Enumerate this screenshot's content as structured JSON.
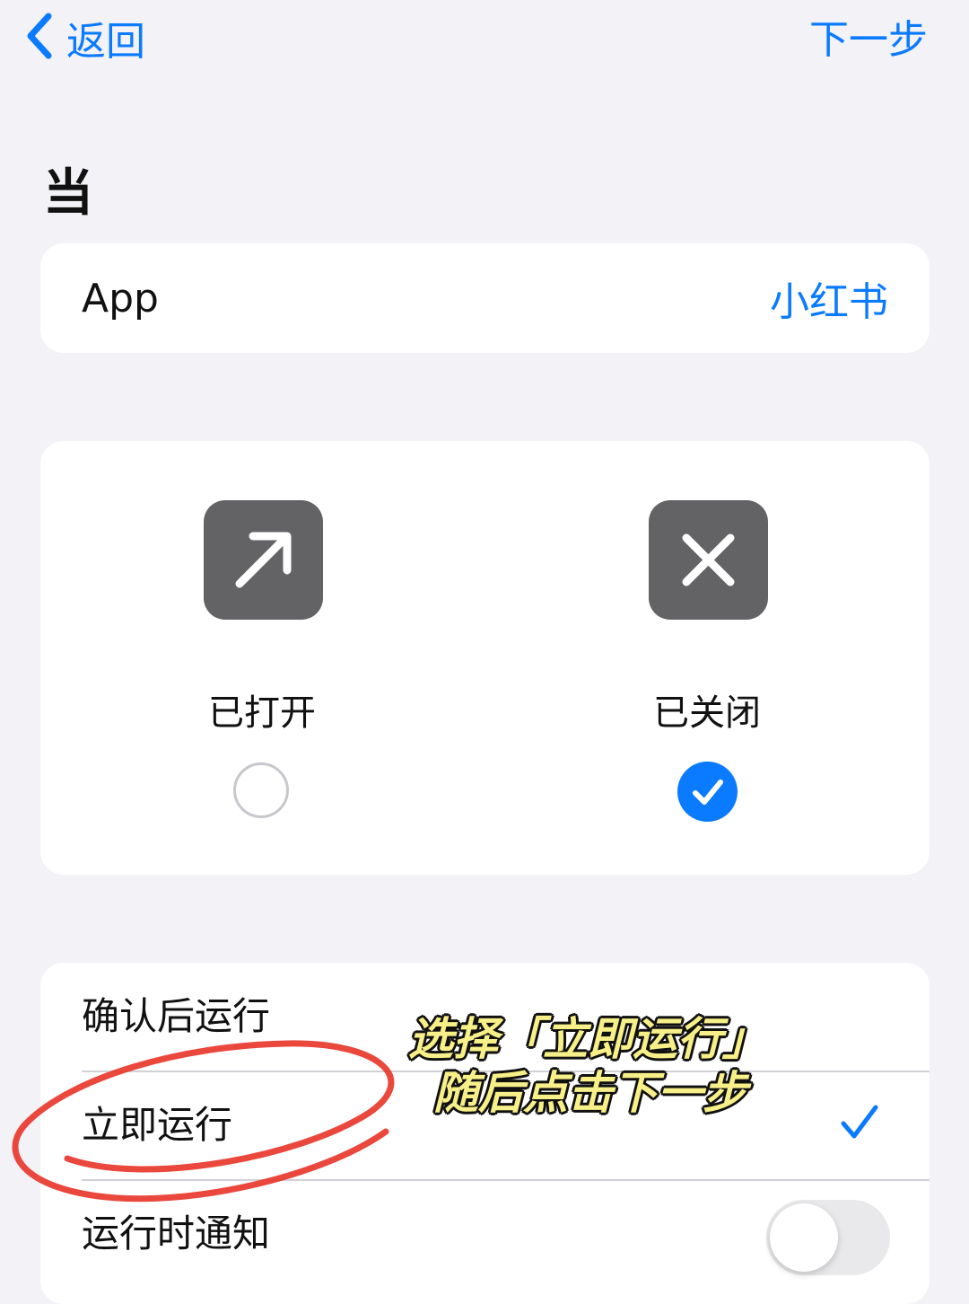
{
  "nav": {
    "back_label": "返回",
    "next_label": "下一步"
  },
  "section": {
    "title": "当"
  },
  "app_row": {
    "label": "App",
    "value": "小红书"
  },
  "state_options": [
    {
      "label": "已打开",
      "icon": "arrow-up-right-icon",
      "selected": false
    },
    {
      "label": "已关闭",
      "icon": "close-x-icon",
      "selected": true
    }
  ],
  "run_options": [
    {
      "label": "确认后运行",
      "checked": false
    },
    {
      "label": "立即运行",
      "checked": true
    }
  ],
  "notify": {
    "label": "运行时通知",
    "enabled": false
  },
  "annotation": {
    "line1": "选择「立即运行」",
    "line2": "随后点击下一步"
  },
  "colors": {
    "accent": "#0a7aff",
    "background": "#f2f2f7",
    "icon_tile": "#636366",
    "annotation_ring": "#e8382c",
    "annotation_text": "#f7ef88"
  }
}
